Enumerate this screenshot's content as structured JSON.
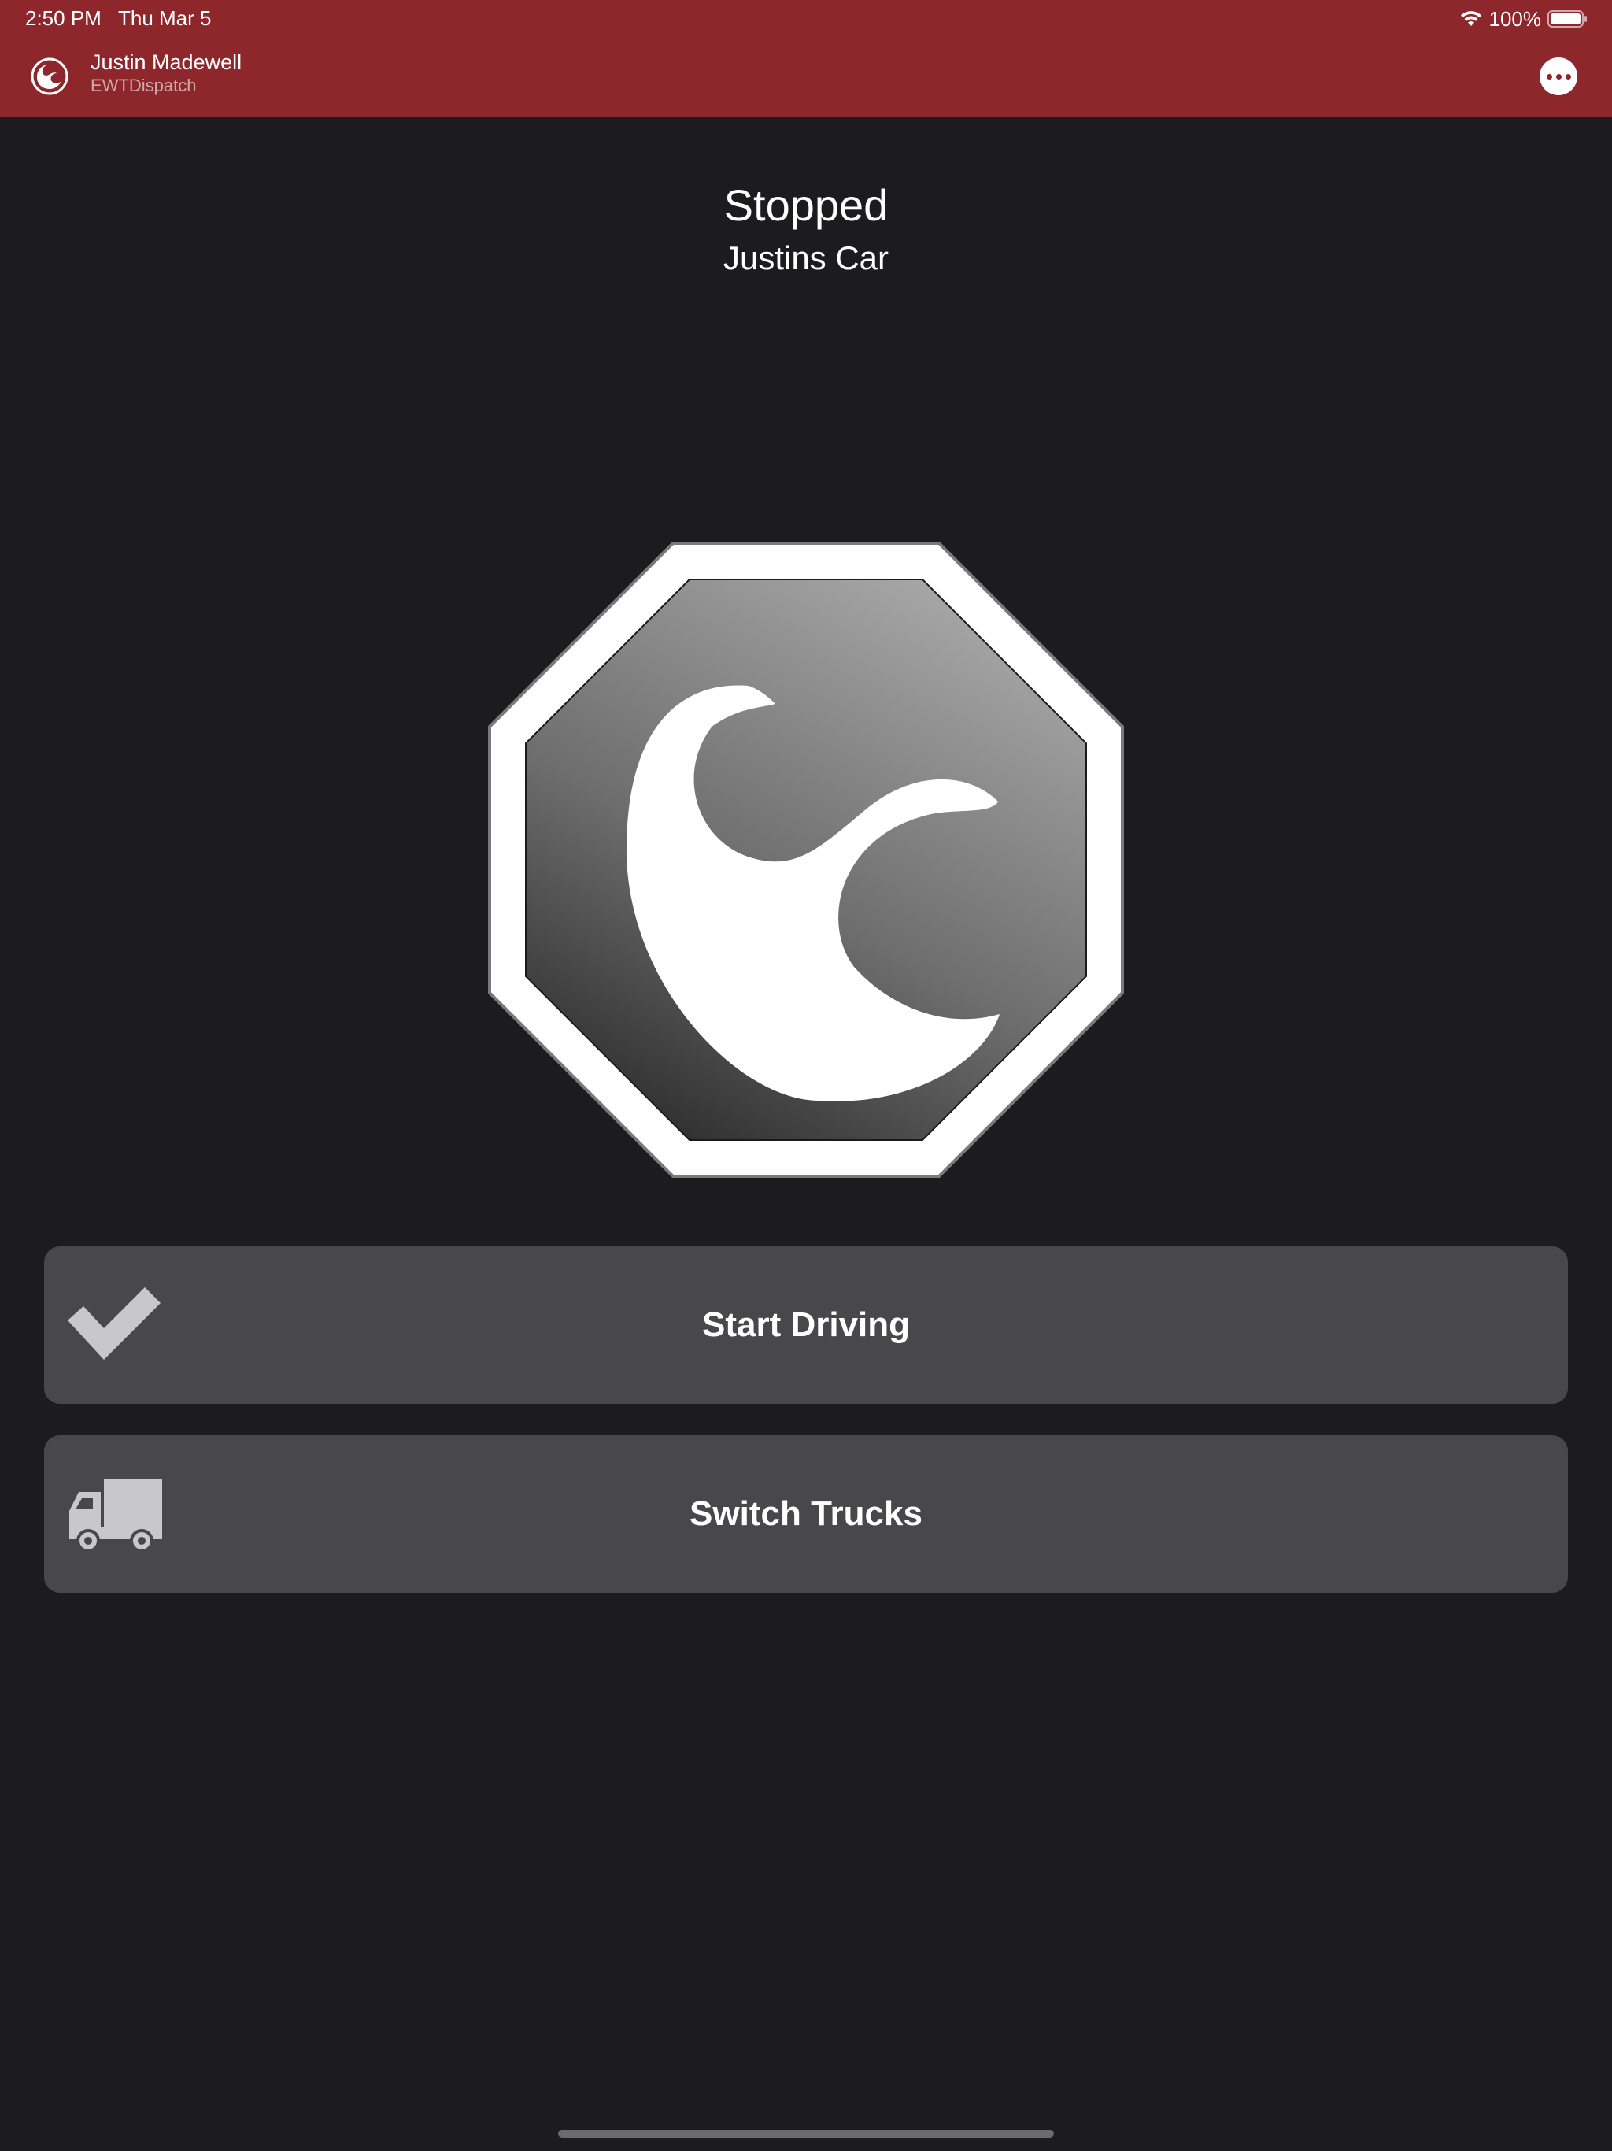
{
  "status_bar": {
    "time": "2:50 PM",
    "date": "Thu Mar 5",
    "battery": "100%",
    "icons": [
      "wifi-icon",
      "battery-icon"
    ]
  },
  "header": {
    "user_name": "Justin Madewell",
    "org_name": "EWTDispatch",
    "logo_icon": "wave-logo-icon",
    "more_icon": "ellipsis-icon"
  },
  "main": {
    "status": "Stopped",
    "vehicle": "Justins Car",
    "status_icon": "stop-sign-wave-icon"
  },
  "actions": [
    {
      "label": "Start Driving",
      "icon": "checkmark-icon"
    },
    {
      "label": "Switch Trucks",
      "icon": "truck-icon"
    }
  ],
  "colors": {
    "header": "#8d272c",
    "background": "#1c1c1e",
    "button": "#48484a",
    "icon_gray": "#c7c7cc"
  }
}
